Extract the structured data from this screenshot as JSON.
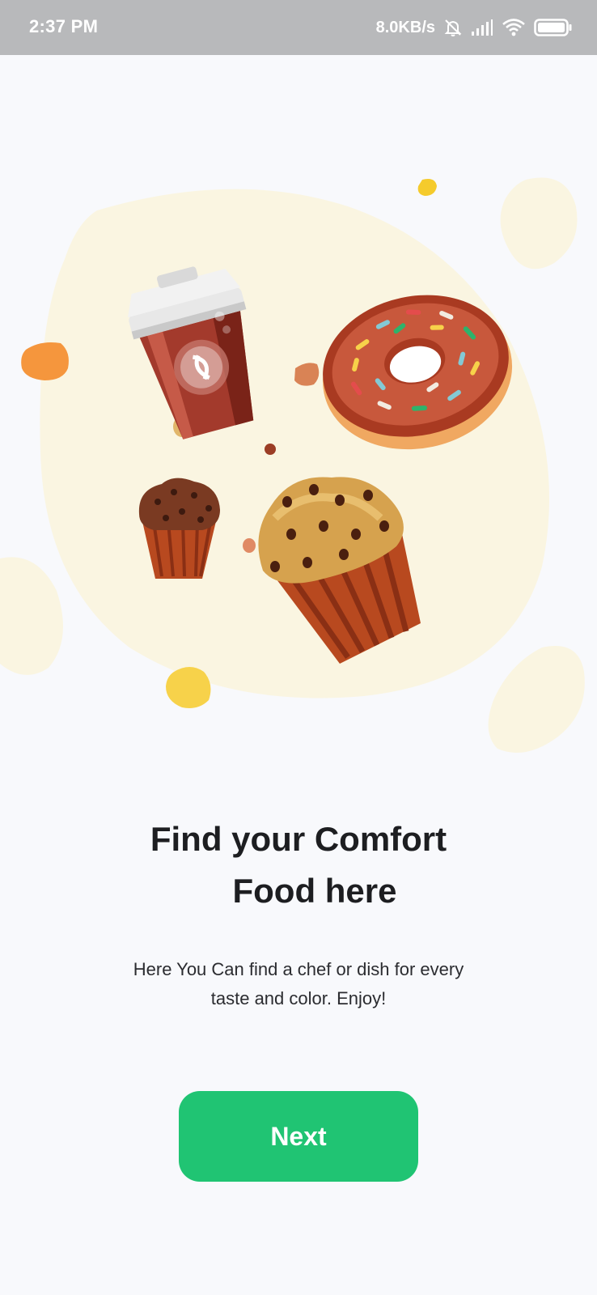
{
  "status_bar": {
    "time": "2:37 PM",
    "network_speed": "8.0KB/s",
    "icons": [
      "mute-bell-icon",
      "signal-icon",
      "wifi-icon",
      "battery-icon"
    ]
  },
  "illustration": {
    "items": [
      "coffee-cup",
      "donut",
      "small-muffin",
      "large-muffin"
    ]
  },
  "onboarding": {
    "title_line1": "Find your Comfort",
    "title_line2": "Food here",
    "subtitle_line1": "Here You Can find a chef or dish for every",
    "subtitle_line2": "taste and color. Enjoy!",
    "next_label": "Next"
  },
  "colors": {
    "accent": "#20c473",
    "status_bar": "#b8b9bb",
    "blob": "#faf5e1",
    "background": "#f8f9fc"
  }
}
